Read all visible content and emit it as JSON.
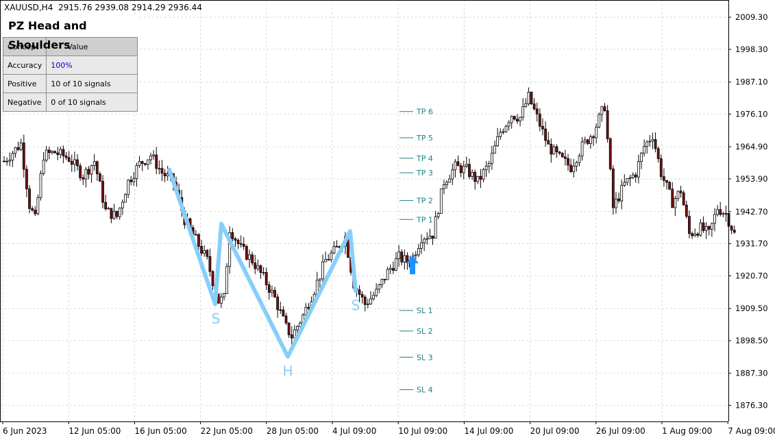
{
  "header": {
    "symbol": "XAUUSD,H4",
    "ohlc": "2915.76 2939.08 2914.29 2936.44"
  },
  "panel": {
    "title": "PZ Head and Shoulders",
    "columns": [
      "Concept",
      "Value"
    ],
    "rows": [
      {
        "concept": "Accuracy",
        "value": "100%",
        "value_color": "#0000dd"
      },
      {
        "concept": "Positive",
        "value": "10 of 10 signals",
        "value_color": "#000000"
      },
      {
        "concept": "Negative",
        "value": "0 of 10 signals",
        "value_color": "#000000"
      }
    ]
  },
  "colors": {
    "bull_candle": "#000000",
    "bear_candle": "#7a1010",
    "pattern_line": "#87cefa",
    "level_line": "#1a8080",
    "arrow": "#1e90ff",
    "grid": "#d8d8d8"
  },
  "chart_data": {
    "type": "candlestick",
    "y_axis": {
      "range": [
        1870.8,
        2015.2
      ],
      "tick_labels": [
        "2009.30",
        "1998.30",
        "1987.10",
        "1976.10",
        "1964.90",
        "1953.90",
        "1942.70",
        "1931.70",
        "1920.70",
        "1909.50",
        "1898.50",
        "1887.30",
        "1876.30"
      ]
    },
    "x_axis": {
      "tick_labels": [
        "6 Jun 2023",
        "12 Jun 05:00",
        "16 Jun 05:00",
        "22 Jun 05:00",
        "28 Jun 05:00",
        "4 Jul 09:00",
        "10 Jul 09:00",
        "14 Jul 09:00",
        "20 Jul 09:00",
        "26 Jul 09:00",
        "1 Aug 09:00",
        "7 Aug 09:00"
      ]
    },
    "close_path": [
      [
        0,
        1960
      ],
      [
        6,
        1966
      ],
      [
        9,
        1945
      ],
      [
        11,
        1940
      ],
      [
        14,
        1962
      ],
      [
        18,
        1963
      ],
      [
        23,
        1961
      ],
      [
        28,
        1955
      ],
      [
        32,
        1960
      ],
      [
        36,
        1943
      ],
      [
        40,
        1941
      ],
      [
        44,
        1953
      ],
      [
        48,
        1959
      ],
      [
        52,
        1962
      ],
      [
        56,
        1956
      ],
      [
        60,
        1953
      ],
      [
        64,
        1940
      ],
      [
        68,
        1933
      ],
      [
        72,
        1926
      ],
      [
        76,
        1912
      ],
      [
        78,
        1913
      ],
      [
        80,
        1937
      ],
      [
        84,
        1930
      ],
      [
        88,
        1926
      ],
      [
        92,
        1920
      ],
      [
        96,
        1913
      ],
      [
        100,
        1903
      ],
      [
        102,
        1900
      ],
      [
        106,
        1907
      ],
      [
        110,
        1916
      ],
      [
        114,
        1926
      ],
      [
        118,
        1930
      ],
      [
        121,
        1934
      ],
      [
        124,
        1918
      ],
      [
        128,
        1911
      ],
      [
        132,
        1915
      ],
      [
        136,
        1922
      ],
      [
        140,
        1927
      ],
      [
        144,
        1925
      ],
      [
        148,
        1934
      ],
      [
        152,
        1935
      ],
      [
        156,
        1953
      ],
      [
        160,
        1958
      ],
      [
        164,
        1957
      ],
      [
        168,
        1953
      ],
      [
        172,
        1959
      ],
      [
        176,
        1970
      ],
      [
        180,
        1976
      ],
      [
        183,
        1975
      ],
      [
        186,
        1982
      ],
      [
        189,
        1975
      ],
      [
        193,
        1965
      ],
      [
        197,
        1961
      ],
      [
        201,
        1958
      ],
      [
        205,
        1965
      ],
      [
        209,
        1970
      ],
      [
        213,
        1979
      ],
      [
        216,
        1944
      ],
      [
        220,
        1952
      ],
      [
        224,
        1956
      ],
      [
        227,
        1965
      ],
      [
        230,
        1969
      ],
      [
        233,
        1956
      ],
      [
        237,
        1946
      ],
      [
        240,
        1950
      ],
      [
        243,
        1935
      ],
      [
        247,
        1937
      ],
      [
        250,
        1935
      ],
      [
        253,
        1944
      ],
      [
        256,
        1942
      ],
      [
        259,
        1935
      ]
    ],
    "pattern": {
      "points": [
        {
          "label": "",
          "price": 1957.0
        },
        {
          "label": "S",
          "price": 1911.0
        },
        {
          "label": "",
          "price": 1938.5
        },
        {
          "label": "H",
          "price": 1893.0
        },
        {
          "label": "",
          "price": 1936.0
        },
        {
          "label": "S",
          "price": 1915.5
        }
      ]
    },
    "levels": [
      {
        "label": "TP 6",
        "price": 1977.0
      },
      {
        "label": "TP 5",
        "price": 1968.0
      },
      {
        "label": "TP 4",
        "price": 1961.0
      },
      {
        "label": "TP 3",
        "price": 1956.0
      },
      {
        "label": "TP 2",
        "price": 1946.5
      },
      {
        "label": "TP 1",
        "price": 1940.0
      },
      {
        "label": "SL 1",
        "price": 1908.8
      },
      {
        "label": "SL 2",
        "price": 1901.8
      },
      {
        "label": "SL 3",
        "price": 1892.8
      },
      {
        "label": "SL 4",
        "price": 1881.7
      }
    ],
    "signal": {
      "type": "buy-arrow",
      "price": 1924.5
    }
  }
}
